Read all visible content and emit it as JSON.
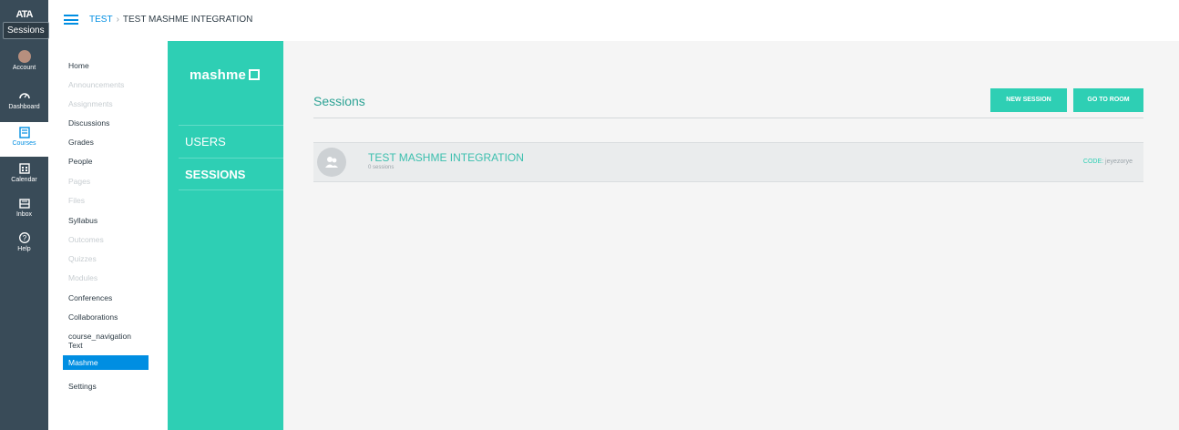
{
  "global_nav": {
    "logo_text": "ATA",
    "tooltip": "Sessions",
    "items": [
      {
        "label": "Account",
        "icon": "account-avatar-icon"
      },
      {
        "label": "Dashboard",
        "icon": "dashboard-icon"
      },
      {
        "label": "Courses",
        "icon": "courses-icon"
      },
      {
        "label": "Calendar",
        "icon": "calendar-icon"
      },
      {
        "label": "Inbox",
        "icon": "inbox-icon"
      },
      {
        "label": "Help",
        "icon": "help-icon"
      }
    ]
  },
  "breadcrumb": {
    "course": "TEST",
    "separator": "›",
    "current": "TEST MASHME INTEGRATION"
  },
  "course_nav": {
    "items": [
      {
        "label": "Home",
        "state": "normal"
      },
      {
        "label": "Announcements",
        "state": "disabled"
      },
      {
        "label": "Assignments",
        "state": "disabled"
      },
      {
        "label": "Discussions",
        "state": "normal"
      },
      {
        "label": "Grades",
        "state": "normal"
      },
      {
        "label": "People",
        "state": "normal"
      },
      {
        "label": "Pages",
        "state": "disabled"
      },
      {
        "label": "Files",
        "state": "disabled"
      },
      {
        "label": "Syllabus",
        "state": "normal"
      },
      {
        "label": "Outcomes",
        "state": "disabled"
      },
      {
        "label": "Quizzes",
        "state": "disabled"
      },
      {
        "label": "Modules",
        "state": "disabled"
      },
      {
        "label": "Conferences",
        "state": "normal"
      },
      {
        "label": "Collaborations",
        "state": "normal"
      },
      {
        "label": "course_navigation",
        "label2": "Text",
        "state": "normal"
      },
      {
        "label": "Mashme",
        "state": "active"
      },
      {
        "label": "Settings",
        "state": "normal"
      }
    ]
  },
  "mashme_sidebar": {
    "logo": "mashme",
    "links": [
      "USERS",
      "SESSIONS"
    ]
  },
  "main": {
    "title": "Sessions",
    "new_session_label": "NEW SESSION",
    "go_to_room_label": "GO TO ROOM",
    "session": {
      "name": "TEST MASHME INTEGRATION",
      "count": "0 sessions",
      "code_label": "CODE:",
      "code_value": "jeyezorye"
    }
  },
  "colors": {
    "accent": "#2ecfb4",
    "canvas_blue": "#008ee2",
    "nav_dark": "#394b58"
  }
}
